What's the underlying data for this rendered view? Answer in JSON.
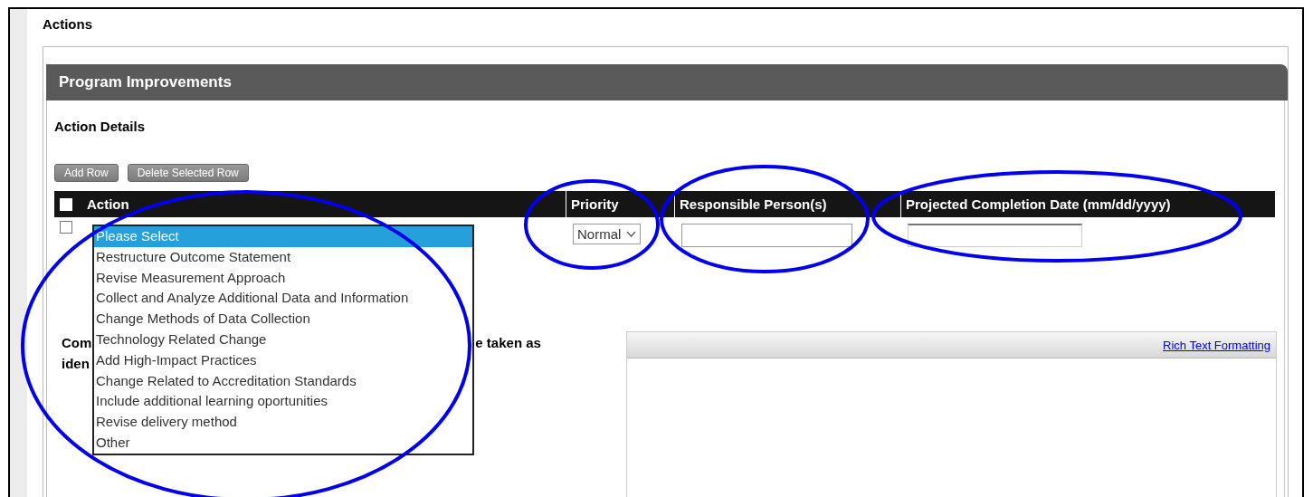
{
  "section_title": "Actions",
  "panel": {
    "title": "Program Improvements",
    "subtitle": "Action Details",
    "buttons": [
      "Add Row",
      "Delete Selected Row"
    ],
    "table": {
      "select_all_checked": false,
      "columns": [
        "Action",
        "Priority",
        "Responsible Person(s)",
        "Projected Completion Date (mm/dd/yyyy)"
      ],
      "rows": [
        {
          "checked": false,
          "priority": "Normal",
          "dropdown_open": true,
          "action_options": [
            {
              "label": "Please Select",
              "selected": true
            },
            {
              "label": "Restructure Outcome Statement",
              "selected": false
            },
            {
              "label": "Revise Measurement Approach",
              "selected": false
            },
            {
              "label": "Collect and Analyze Additional Data and Information",
              "selected": false
            },
            {
              "label": "Change Methods of Data Collection",
              "selected": false
            },
            {
              "label": "Technology Related Change",
              "selected": false
            },
            {
              "label": "Add High-Impact Practices",
              "selected": false
            },
            {
              "label": "Change Related to Accreditation Standards",
              "selected": false
            },
            {
              "label": "Include additional learning oportunities",
              "selected": false
            },
            {
              "label": "Revise delivery method",
              "selected": false
            },
            {
              "label": "Other",
              "selected": false
            }
          ]
        }
      ]
    },
    "comment_label_fragments": {
      "line_1_start": "Com",
      "line_1_end": "e taken as",
      "line_2_start": "iden"
    },
    "editor": {
      "link": "Rich Text Formatting"
    }
  }
}
